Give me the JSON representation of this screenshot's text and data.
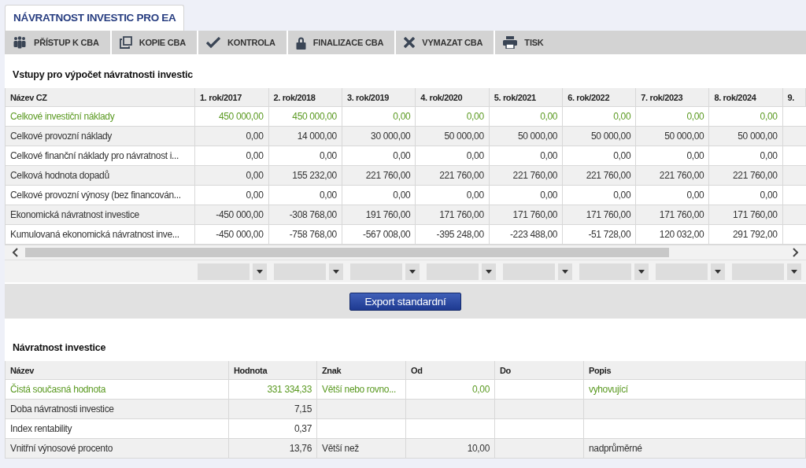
{
  "tab": {
    "label": "NÁVRATNOST INVESTIC PRO EA",
    "selected": true
  },
  "toolbar": [
    {
      "label": "PŘÍSTUP K CBA",
      "kind": "people"
    },
    {
      "label": "KOPIE CBA",
      "kind": "copy"
    },
    {
      "label": "KONTROLA",
      "kind": "check"
    },
    {
      "label": "FINALIZACE CBA",
      "kind": "lock"
    },
    {
      "label": "VYMAZAT CBA",
      "kind": "delete"
    },
    {
      "label": "TISK",
      "kind": "print"
    }
  ],
  "inputs": {
    "title": "Vstupy pro výpočet návratnosti investic",
    "columns": [
      "Název CZ",
      "1. rok/2017",
      "2. rok/2018",
      "3. rok/2019",
      "4. rok/2020",
      "5. rok/2021",
      "6. rok/2022",
      "7. rok/2023",
      "8. rok/2024",
      "9."
    ],
    "rows": [
      {
        "name": "Celkové investiční náklady",
        "selected": true,
        "values": [
          "450 000,00",
          "450 000,00",
          "0,00",
          "0,00",
          "0,00",
          "0,00",
          "0,00",
          "0,00"
        ]
      },
      {
        "name": "Celkové provozní náklady",
        "selected": false,
        "values": [
          "0,00",
          "14 000,00",
          "30 000,00",
          "50 000,00",
          "50 000,00",
          "50 000,00",
          "50 000,00",
          "50 000,00"
        ]
      },
      {
        "name": "Celkové finanční náklady pro návratnost i...",
        "selected": false,
        "values": [
          "0,00",
          "0,00",
          "0,00",
          "0,00",
          "0,00",
          "0,00",
          "0,00",
          "0,00"
        ]
      },
      {
        "name": "Celková hodnota dopadů",
        "selected": false,
        "values": [
          "0,00",
          "155 232,00",
          "221 760,00",
          "221 760,00",
          "221 760,00",
          "221 760,00",
          "221 760,00",
          "221 760,00"
        ]
      },
      {
        "name": "Celkové provozní výnosy (bez financován...",
        "selected": false,
        "values": [
          "0,00",
          "0,00",
          "0,00",
          "0,00",
          "0,00",
          "0,00",
          "0,00",
          "0,00"
        ]
      },
      {
        "name": "Ekonomická návratnost investice",
        "selected": false,
        "values": [
          "-450 000,00",
          "-308 768,00",
          "191 760,00",
          "171 760,00",
          "171 760,00",
          "171 760,00",
          "171 760,00",
          "171 760,00"
        ]
      },
      {
        "name": "Kumulovaná ekonomická návratnost inve...",
        "selected": false,
        "values": [
          "-450 000,00",
          "-758 768,00",
          "-567 008,00",
          "-395 248,00",
          "-223 488,00",
          "-51 728,00",
          "120 032,00",
          "291 792,00"
        ]
      }
    ],
    "export_button": "Export standardní"
  },
  "result": {
    "title": "Návratnost investice",
    "columns": [
      "Název",
      "Hodnota",
      "Znak",
      "Od",
      "Do",
      "Popis"
    ],
    "rows": [
      {
        "selected": true,
        "cells": [
          "Čistá současná hodnota",
          "331 334,33",
          "Větší nebo rovno...",
          "0,00",
          "",
          "vyhovující"
        ]
      },
      {
        "selected": false,
        "cells": [
          "Doba návratnosti investice",
          "7,15",
          "",
          "",
          "",
          ""
        ]
      },
      {
        "selected": false,
        "cells": [
          "Index rentability",
          "0,37",
          "",
          "",
          "",
          ""
        ]
      },
      {
        "selected": false,
        "cells": [
          "Vnitřní výnosové procento",
          "13,76",
          "Větší než",
          "10,00",
          "",
          "nadprůměrné"
        ]
      }
    ]
  }
}
